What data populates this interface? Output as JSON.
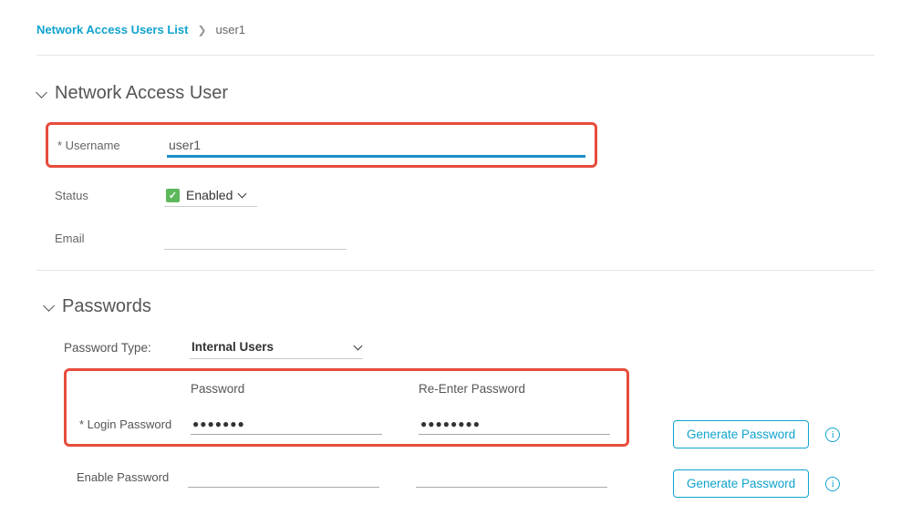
{
  "breadcrumb": {
    "link": "Network Access Users List",
    "current": "user1"
  },
  "section_user": {
    "title": "Network Access User",
    "username_label": "Username",
    "username_value": "user1",
    "status_label": "Status",
    "status_value": "Enabled",
    "email_label": "Email",
    "email_value": ""
  },
  "section_pw": {
    "title": "Passwords",
    "type_label": "Password Type:",
    "type_value": "Internal Users",
    "col_password": "Password",
    "col_reenter": "Re-Enter Password",
    "login_label": "Login Password",
    "login_pw": "●●●●●●●",
    "login_repw": "●●●●●●●●",
    "enable_label": "Enable Password",
    "enable_pw": "",
    "enable_repw": "",
    "gen_btn": "Generate Password"
  }
}
